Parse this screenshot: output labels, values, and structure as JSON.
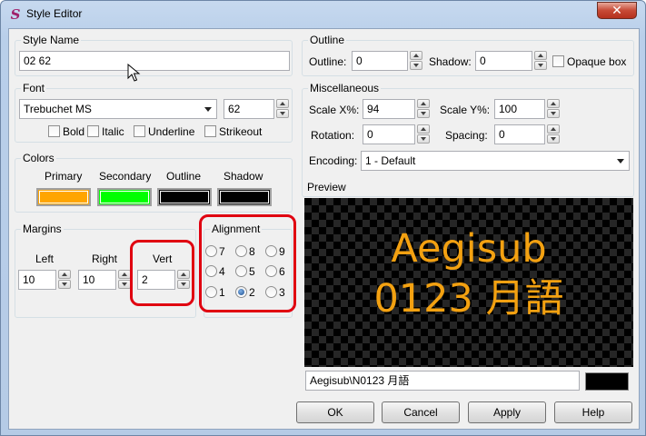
{
  "window": {
    "title": "Style Editor",
    "close": "✕"
  },
  "style_name": {
    "group": "Style Name",
    "value": "02 62"
  },
  "font": {
    "group": "Font",
    "family": "Trebuchet MS",
    "size": "62",
    "bold": "Bold",
    "italic": "Italic",
    "underline": "Underline",
    "strikeout": "Strikeout"
  },
  "colors": {
    "group": "Colors",
    "primary": "Primary",
    "secondary": "Secondary",
    "outline": "Outline",
    "shadow": "Shadow",
    "primary_color": "#ffa500",
    "secondary_color": "#00ff00",
    "outline_color": "#000000",
    "shadow_color": "#000000"
  },
  "margins": {
    "group": "Margins",
    "left_label": "Left",
    "right_label": "Right",
    "vert_label": "Vert",
    "left": "10",
    "right": "10",
    "vert": "2"
  },
  "alignment": {
    "group": "Alignment",
    "options": [
      "7",
      "8",
      "9",
      "4",
      "5",
      "6",
      "1",
      "2",
      "3"
    ],
    "selected": "2"
  },
  "outline": {
    "group": "Outline",
    "outline_label": "Outline:",
    "outline_value": "0",
    "shadow_label": "Shadow:",
    "shadow_value": "0",
    "opaque": "Opaque box"
  },
  "misc": {
    "group": "Miscellaneous",
    "scalex_label": "Scale X%:",
    "scalex": "94",
    "scaley_label": "Scale Y%:",
    "scaley": "100",
    "rotation_label": "Rotation:",
    "rotation": "0",
    "spacing_label": "Spacing:",
    "spacing": "0",
    "encoding_label": "Encoding:",
    "encoding": "1 - Default"
  },
  "preview": {
    "group": "Preview",
    "line1": "Aegisub",
    "line2": "0123 月語",
    "text": "Aegisub\\N0123 月語"
  },
  "buttons": {
    "ok": "OK",
    "cancel": "Cancel",
    "apply": "Apply",
    "help": "Help"
  }
}
